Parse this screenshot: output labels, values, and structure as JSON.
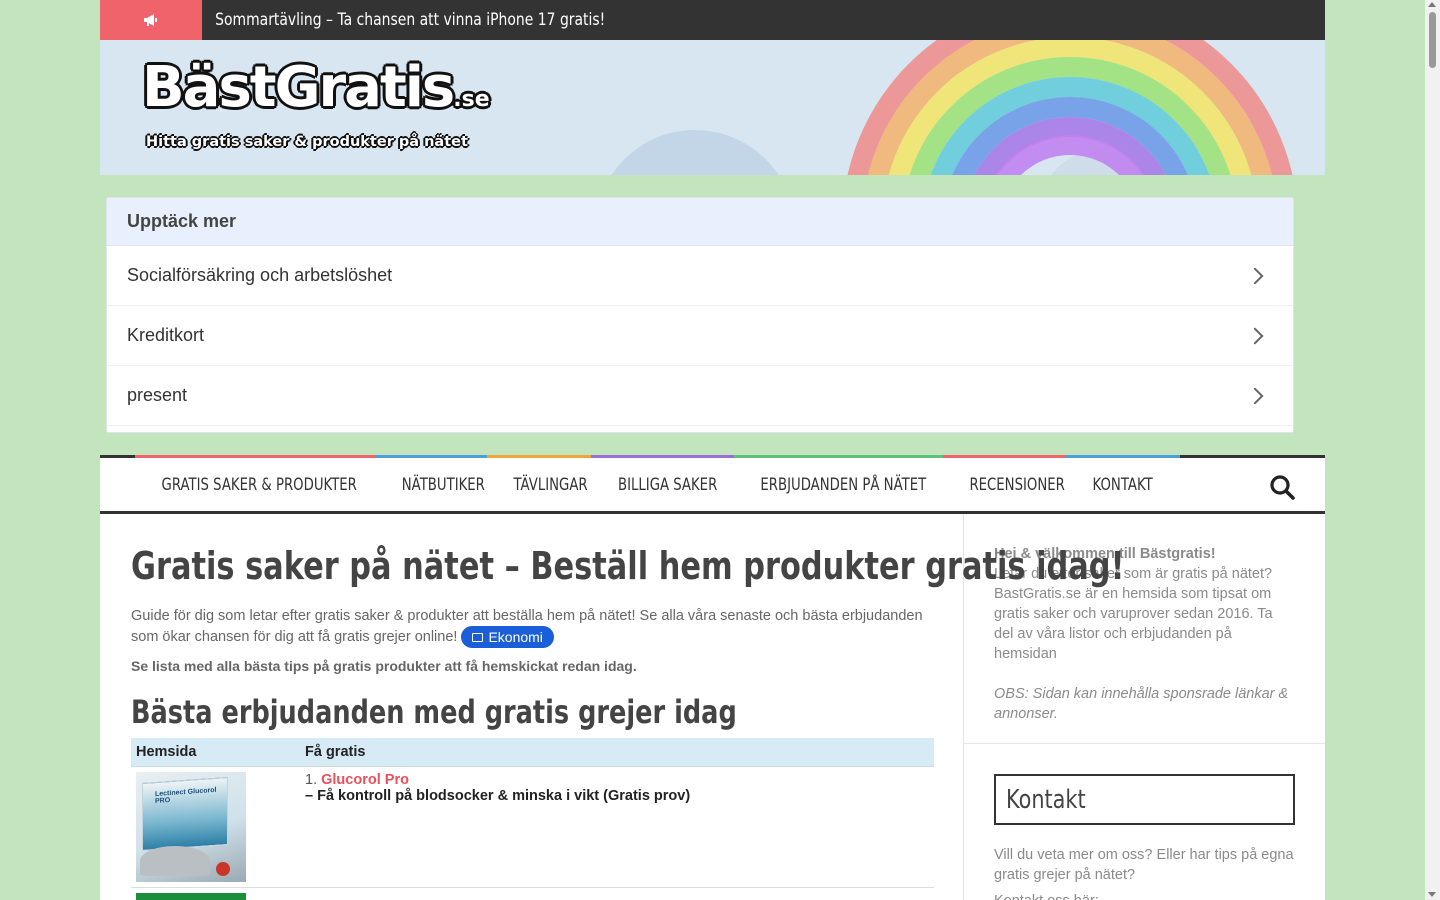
{
  "topbar": {
    "ticker": "Sommartävling – Ta chansen att vinna iPhone 17 gratis!",
    "icon": "megaphone-icon"
  },
  "logo": {
    "main": "BästGratis",
    "tld": ".se",
    "tagline": "Hitta gratis saker & produkter på nätet"
  },
  "discover": {
    "heading": "Upptäck mer",
    "items": [
      "Socialförsäkring och arbetslöshet",
      "Kreditkort",
      "present"
    ]
  },
  "nav": {
    "items": [
      "GRATIS SAKER & PRODUKTER",
      "NÄTBUTIKER",
      "TÄVLINGAR",
      "BILLIGA SAKER",
      "ERBJUDANDEN PÅ NÄTET",
      "RECENSIONER",
      "KONTAKT"
    ],
    "bar_colors": [
      "#f0636b",
      "#4d9fd8",
      "#f0a53b",
      "#9b6fd6",
      "#5fc07a",
      "#f0636b",
      "#4d9fd8"
    ]
  },
  "main": {
    "title": "Gratis saker på nätet – Beställ hem produkter gratis idag!",
    "intro": "Guide för dig som letar efter gratis saker & produkter att beställa hem på nätet! Se alla våra senaste och bästa erbjudanden som ökar chansen för dig att få gratis grejer online!",
    "badge": "Ekonomi",
    "bold_line": "Se lista med alla bästa tips på gratis produkter att få hemskickat redan idag.",
    "subtitle": "Bästa erbjudanden med gratis grejer idag",
    "table": {
      "headers": [
        "Hemsida",
        "Få gratis"
      ],
      "rows": [
        {
          "num": "1.",
          "link": "Glucorol Pro",
          "desc": "– Få kontroll på blodsocker & minska i vikt (Gratis prov)",
          "img_label": "Lectinect Glucorol PRO"
        }
      ]
    }
  },
  "sidebar": {
    "welcome_bold": "Hej & välkommen till Bästgratis!",
    "welcome_text": "Letar du efter saker som är gratis på nätet? BastGratis.se är en hemsida som tipsat om gratis saker och varuprover sedan 2016. Ta del av våra listor och erbjudanden på hemsidan",
    "welcome_note": "OBS: Sidan kan innehålla sponsrade länkar & annonser.",
    "contact_title": "Kontakt",
    "contact_text": "Vill du veta mer om oss? Eller har tips på egna gratis grejer på nätet?",
    "contact_more": "Kontakt oss här:"
  },
  "colors": {
    "background": "#c3e5bd",
    "accent": "#f0636b",
    "badge": "#1a5ed8",
    "link": "#e8505b"
  }
}
